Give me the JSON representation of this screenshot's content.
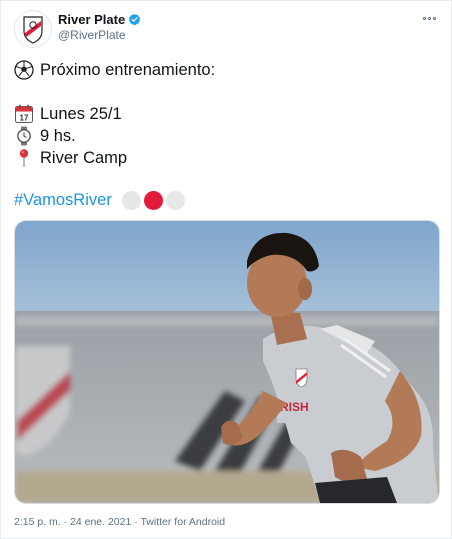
{
  "tweet": {
    "author_name": "River Plate",
    "handle": "@RiverPlate",
    "line1": "Próximo entrenamiento:",
    "line2": "Lunes 25/1",
    "line3": "9 hs.",
    "line4": "River Camp",
    "hashtag": "#VamosRiver",
    "calendar_day": "17",
    "calendar_month": "JUL",
    "footer": "2:15 p. m. · 24 ene. 2021 · Twitter for Android"
  },
  "icons": {
    "soccer": "soccer-ball-icon",
    "calendar": "calendar-icon",
    "watch": "watch-icon",
    "pin": "pin-icon",
    "verified": "verified-badge-icon",
    "more": "more-icon"
  },
  "colors": {
    "link": "#1b95e0",
    "river_red": "#e31b3a",
    "light_grey": "#e6e7e8",
    "muted": "#5b7083"
  }
}
